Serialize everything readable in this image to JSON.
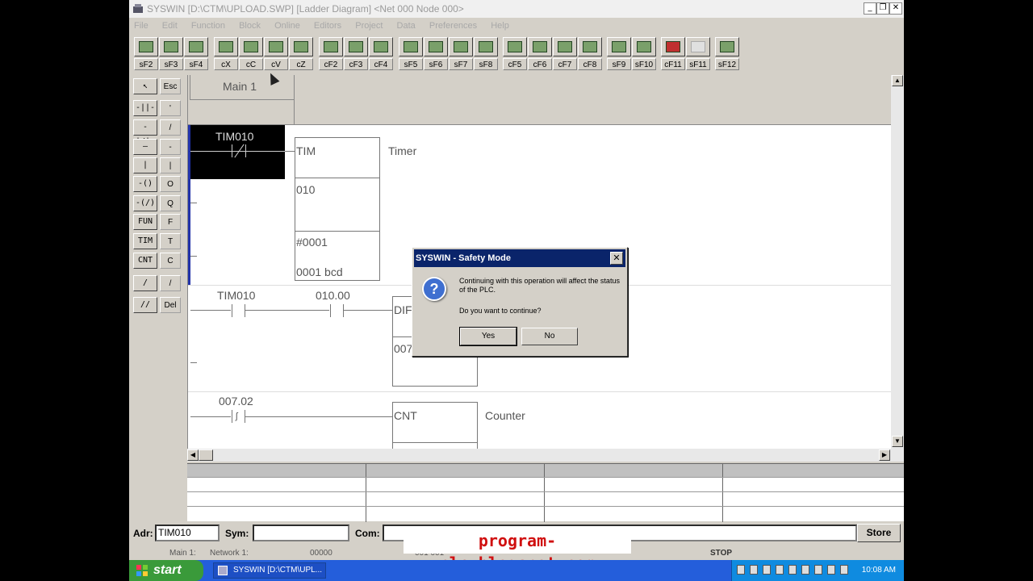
{
  "window": {
    "title": "SYSWIN [D:\\CTM\\UPLOAD.SWP] [Ladder Diagram] <Net 000 Node 000>",
    "buttons": [
      "_",
      "❐",
      "✕"
    ]
  },
  "menu": [
    "File",
    "Edit",
    "Function",
    "Block",
    "Online",
    "Editors",
    "Project",
    "Data",
    "Preferences",
    "Help"
  ],
  "toolbar": {
    "keys": [
      "sF2",
      "sF3",
      "sF4",
      "cX",
      "cC",
      "cV",
      "cZ",
      "cF2",
      "cF3",
      "cF4",
      "sF5",
      "sF6",
      "sF7",
      "sF8",
      "cF5",
      "cF6",
      "cF7",
      "cF8",
      "sF9",
      "sF10",
      "cF11",
      "sF11",
      "sF12"
    ]
  },
  "palette": {
    "keys": [
      "Esc",
      "'",
      "/",
      "-",
      "|",
      "O",
      "Q",
      "F",
      "T",
      "C",
      "/",
      "Del"
    ],
    "buttons": [
      "↖",
      "-||-",
      "-|/|-",
      "—",
      "|",
      "-()",
      "-(/)",
      "FUN",
      "TIM",
      "CNT",
      "/",
      "//"
    ]
  },
  "ladder": {
    "tab_label": "Main 1",
    "rung1": {
      "contact": "TIM010",
      "box_type": "TIM",
      "box_comment": "Timer",
      "operand": "010",
      "preset": "#0001",
      "preset_comment": "0001 bcd"
    },
    "rung2": {
      "contact1": "TIM010",
      "contact2": "010.00",
      "box_type": "DIF",
      "operand": "007"
    },
    "rung3": {
      "contact": "007.02",
      "box_type": "CNT",
      "box_comment": "Counter"
    }
  },
  "dialog": {
    "title": "SYSWIN - Safety Mode",
    "message": "Continuing with this operation will affect the status of the PLC.",
    "question": "Do you want to continue?",
    "yes": "Yes",
    "no": "No",
    "close": "✕",
    "icon": "?"
  },
  "editbar": {
    "adr_label": "Adr:",
    "adr_value": "TIM010",
    "sym_label": "Sym:",
    "sym_value": "",
    "com_label": "Com:",
    "com_value": "",
    "store": "Store"
  },
  "watermark": "program-plc.blogspot.com",
  "status": {
    "section": "Main 1:",
    "network": "Network 1:",
    "address": "00000",
    "position": "001 001",
    "mode": "STOP"
  },
  "taskbar": {
    "start": "start",
    "task": "SYSWIN [D:\\CTM\\UPL...",
    "clock": "10:08 AM"
  }
}
